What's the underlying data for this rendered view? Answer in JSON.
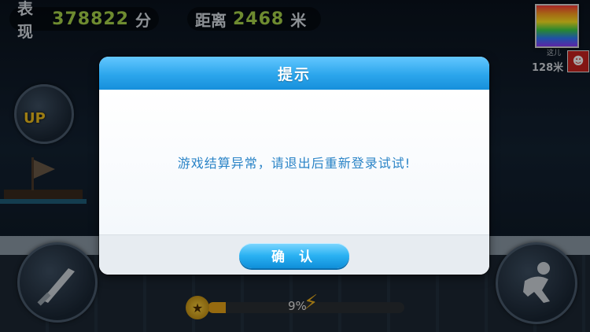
{
  "hud": {
    "score_label": "表现",
    "score_value": "378822",
    "score_unit": "分",
    "distance_label": "距离",
    "distance_value": "2468",
    "distance_unit": "米"
  },
  "rank": {
    "label": "这儿",
    "distance": "128米"
  },
  "skill": {
    "up_label": "UP"
  },
  "energy": {
    "percent_text": "9%",
    "fill_fraction": 0.09
  },
  "dialog": {
    "title": "提示",
    "message": "游戏结算异常，请退出后重新登录试试!",
    "confirm_label": "确 认"
  },
  "colors": {
    "header_blue": "#2ca6ec",
    "message_blue": "#2b84c7",
    "hud_value_green": "#a9d64a",
    "energy_fill": "#e7a318"
  },
  "icons": {
    "attack": "sword-icon",
    "jump": "jump-icon",
    "energy": "star-icon",
    "bolt": "lightning-icon"
  }
}
